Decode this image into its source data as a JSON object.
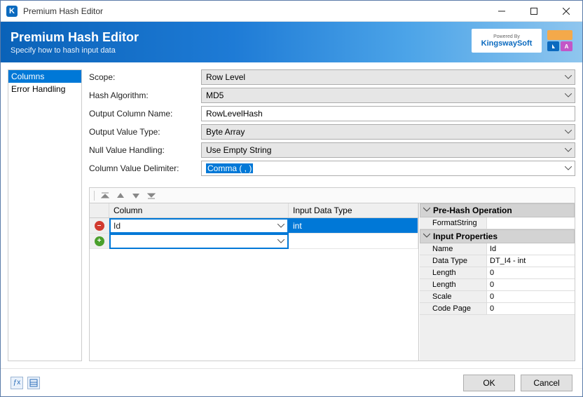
{
  "titlebar": {
    "title": "Premium Hash Editor",
    "app_logo_letter": "K"
  },
  "banner": {
    "heading": "Premium Hash Editor",
    "subtitle": "Specify how to hash input data",
    "powered_by": "Powered By",
    "brand": "KingswaySoft"
  },
  "sidebar": {
    "items": [
      {
        "label": "Columns",
        "selected": true
      },
      {
        "label": "Error Handling",
        "selected": false
      }
    ]
  },
  "form": {
    "scope": {
      "label": "Scope:",
      "value": "Row Level"
    },
    "hash_algorithm": {
      "label": "Hash Algorithm:",
      "value": "MD5"
    },
    "output_column_name": {
      "label": "Output Column Name:",
      "value": "RowLevelHash"
    },
    "output_value_type": {
      "label": "Output Value Type:",
      "value": "Byte Array"
    },
    "null_value_handling": {
      "label": "Null Value Handling:",
      "value": "Use Empty String"
    },
    "column_value_delim": {
      "label": "Column Value Delimiter:",
      "value": "Comma ( , )"
    }
  },
  "grid": {
    "headers": {
      "column": "Column",
      "input_data_type": "Input Data Type"
    },
    "rows": [
      {
        "column": "Id",
        "input_data_type": "int"
      },
      {
        "column": "",
        "input_data_type": ""
      }
    ]
  },
  "props": {
    "sec1": "Pre-Hash Operation",
    "format_string": {
      "key": "FormatString",
      "value": ""
    },
    "sec2": "Input Properties",
    "name": {
      "key": "Name",
      "value": "Id"
    },
    "data_type": {
      "key": "Data Type",
      "value": "DT_I4 - int"
    },
    "length": {
      "key": "Length",
      "value": "0"
    },
    "length2": {
      "key": "Length",
      "value": "0"
    },
    "scale": {
      "key": "Scale",
      "value": "0"
    },
    "code_page": {
      "key": "Code Page",
      "value": "0"
    }
  },
  "footer": {
    "ok": "OK",
    "cancel": "Cancel"
  }
}
